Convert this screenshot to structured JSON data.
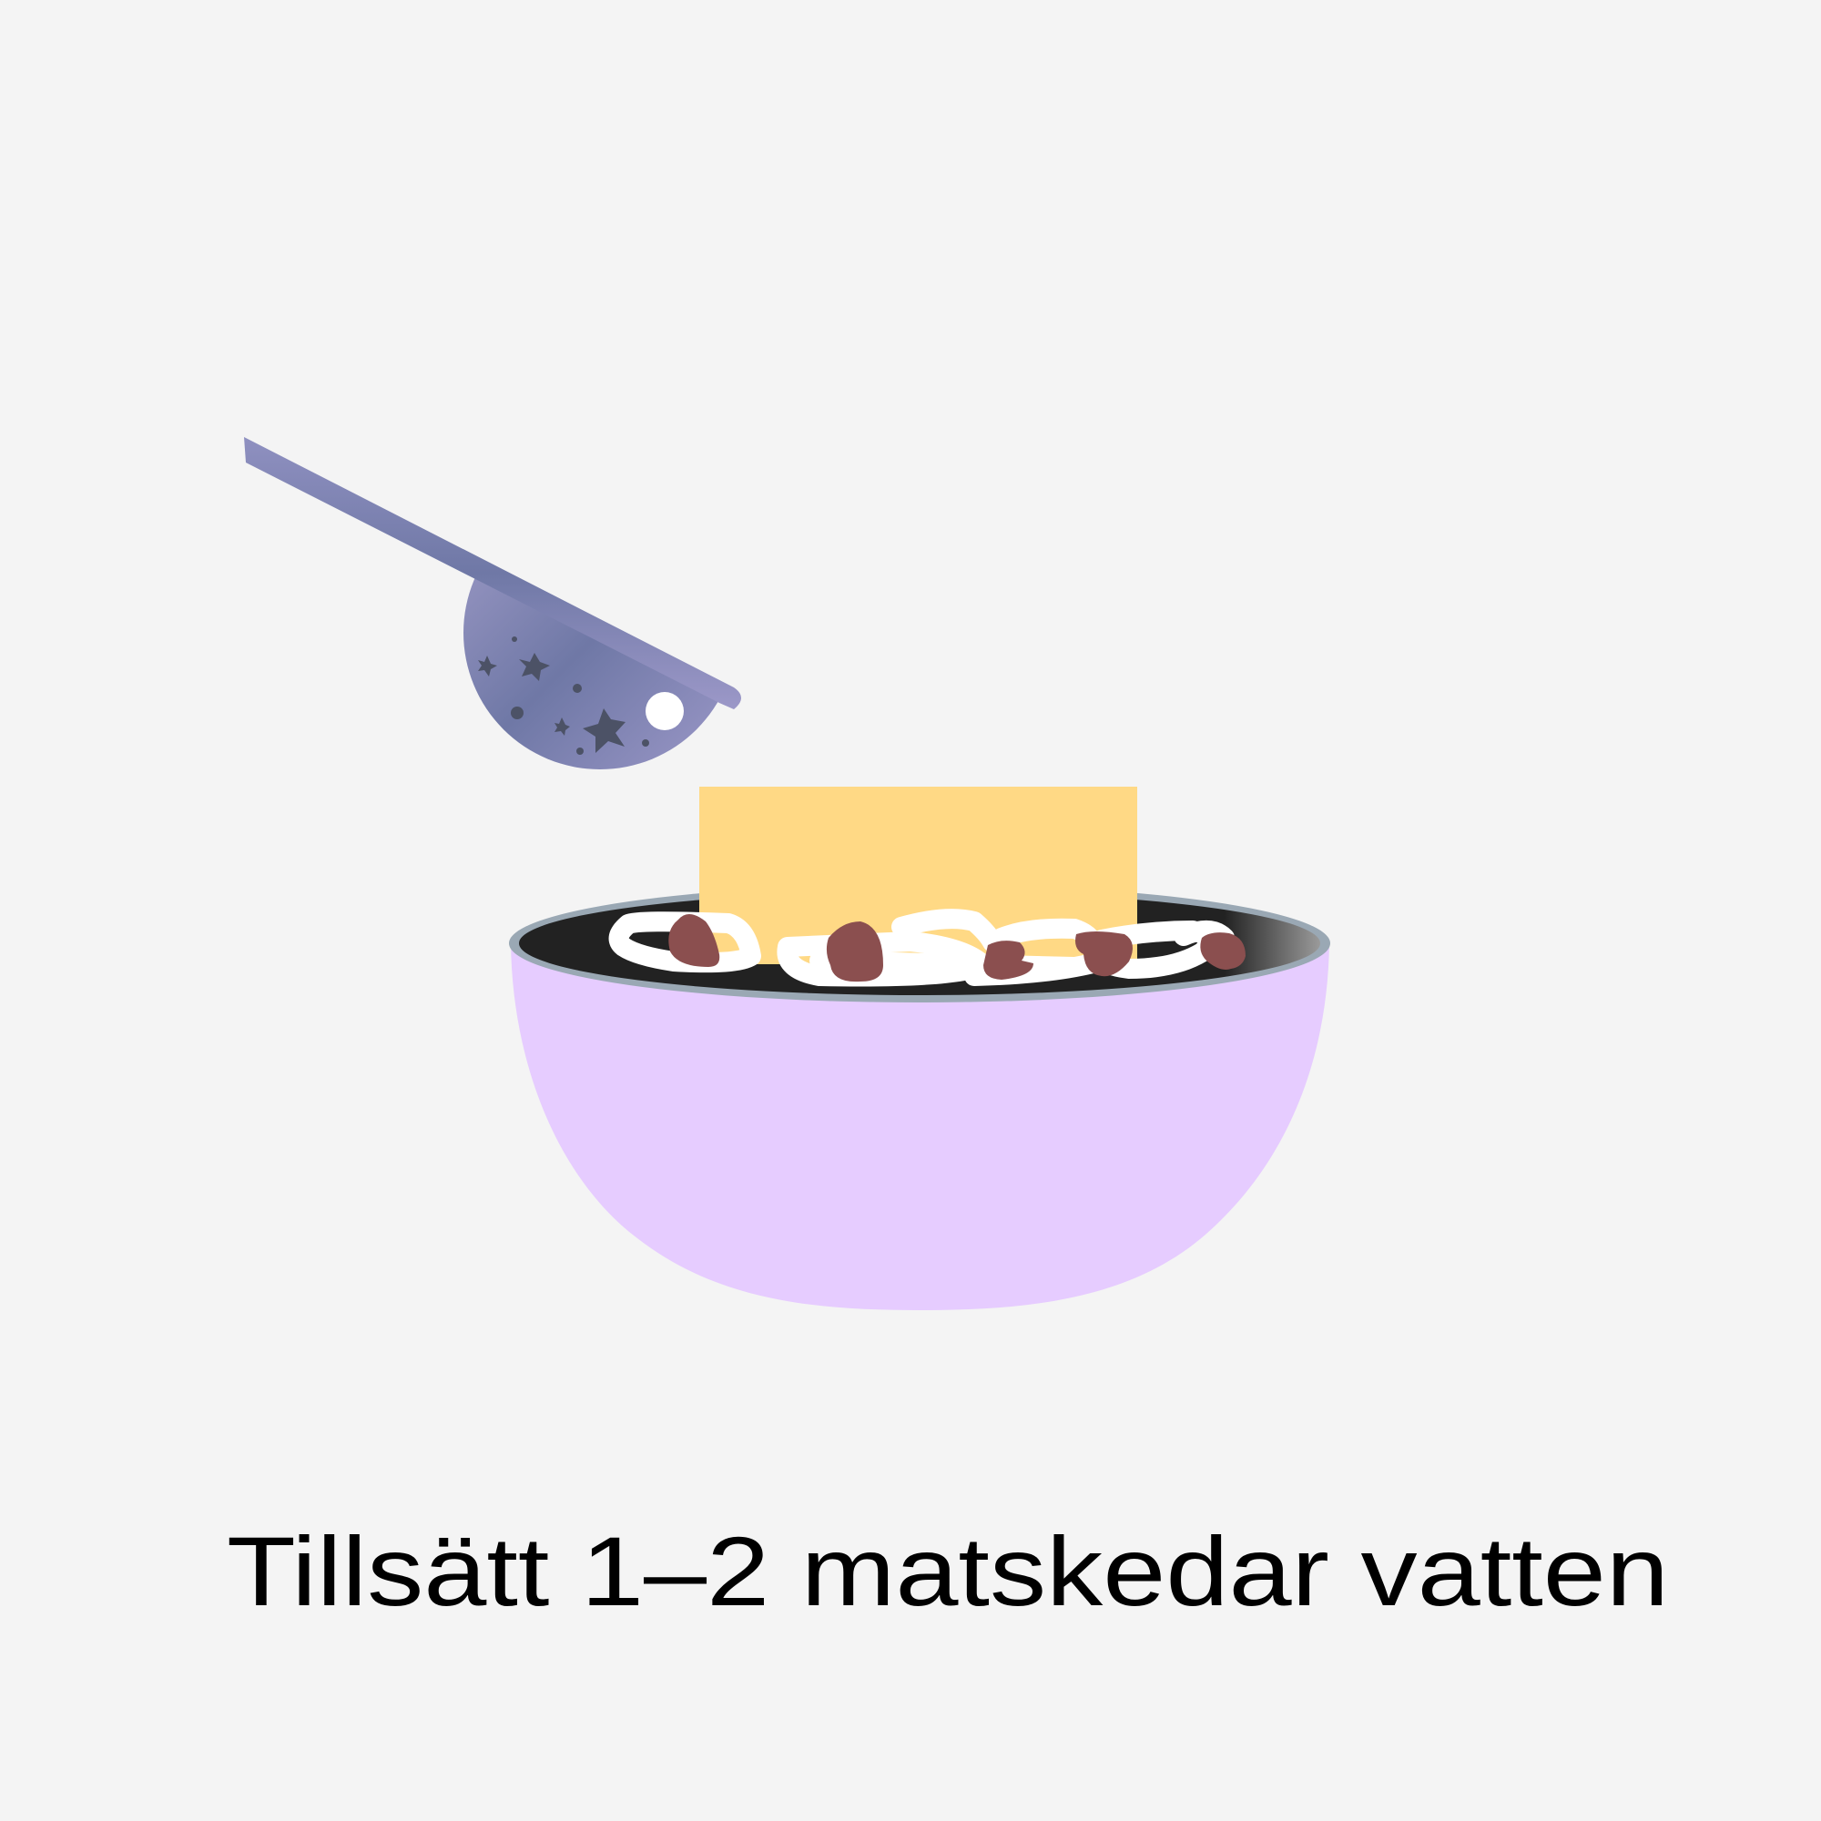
{
  "caption": "Tillsätt 1–2 matskedar vatten",
  "illustration": {
    "icons": [
      "spoon-icon",
      "bowl-icon",
      "noodles-icon",
      "water-icon"
    ],
    "colors": {
      "background": "#f4f4f4",
      "spoon": "#8a8cb8",
      "spoon_dark": "#6f78a6",
      "stars": "#4c5266",
      "bowl": "#e6ccff",
      "rim": "#9aa8b4",
      "broth": "#222222",
      "yellow_block": "#ffd985",
      "noodles": "#ffffff",
      "meat": "#8b4f4f"
    }
  }
}
